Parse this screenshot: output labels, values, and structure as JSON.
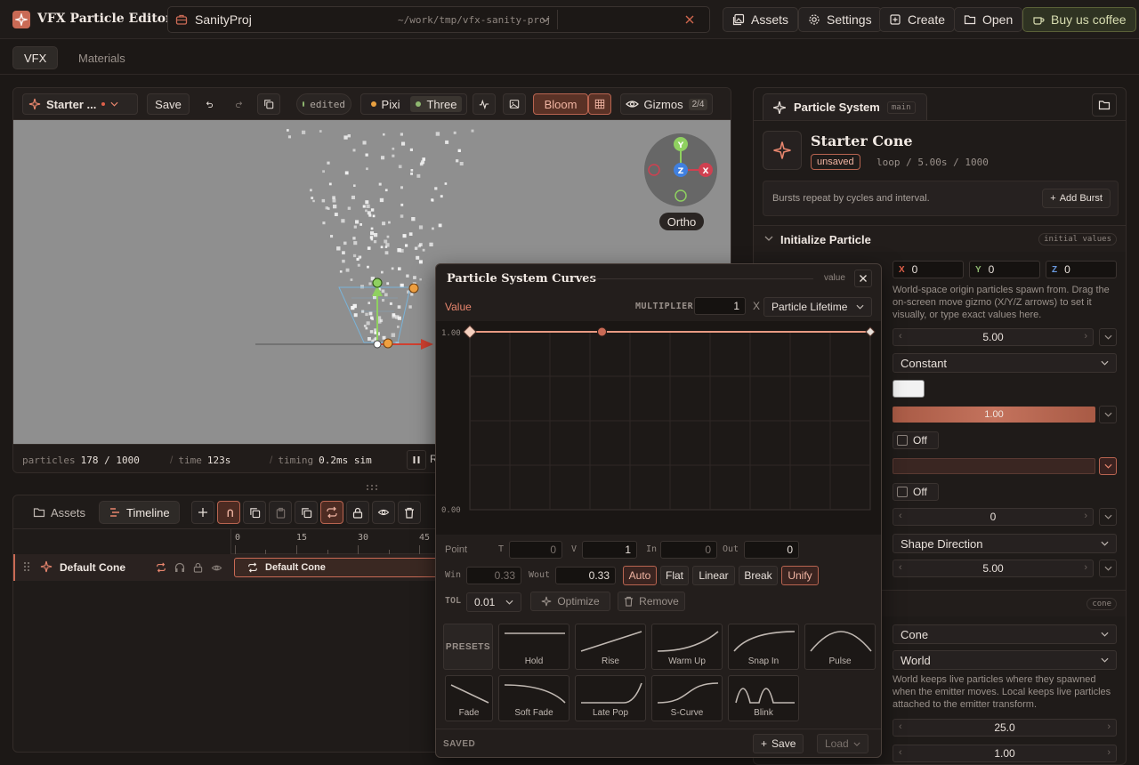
{
  "app": {
    "title": "VFX Particle Editor"
  },
  "project": {
    "name": "SanityProj",
    "path": "~/work/tmp/vfx-sanity-proj"
  },
  "toolbar": {
    "assets": "Assets",
    "settings": "Settings",
    "create": "Create",
    "open": "Open",
    "coffee": "Buy us coffee"
  },
  "main_tabs": [
    "VFX",
    "Materials"
  ],
  "viewport": {
    "system_name": "Starter ...",
    "save": "Save",
    "edited": "edited",
    "renderer_pixi": "Pixi",
    "renderer_three": "Three",
    "bloom": "Bloom",
    "gizmos": "Gizmos",
    "gizmos_count": "2/4",
    "ortho": "Ortho",
    "gizmo_axes": {
      "y": "Y",
      "z": "Z",
      "x": "X"
    },
    "stats": {
      "particles_label": "particles",
      "particles_value": "178 / 1000",
      "time_label": "time",
      "time_value": "123s",
      "timing_label": "timing",
      "timing_value": "0.2ms sim",
      "sep": "/"
    },
    "trailing_char": "R",
    "particle_count": 178,
    "particle_max": 1000
  },
  "bottom": {
    "tab_assets": "Assets",
    "tab_timeline": "Timeline",
    "ruler_ticks": [
      "0",
      "15",
      "30",
      "45"
    ],
    "track_name": "Default Cone",
    "clip_name": "Default Cone"
  },
  "inspector": {
    "tab_label": "Particle System",
    "tab_badge": "main",
    "system_name": "Starter Cone",
    "status": "unsaved",
    "meta": "loop / 5.00s / 1000",
    "burst_note": "Bursts repeat by cycles and interval.",
    "add_burst": "Add Burst",
    "init_title": "Initialize Particle",
    "init_badge": "initial values",
    "pos_x_label": "X",
    "pos_x": "0",
    "pos_y_label": "Y",
    "pos_y": "0",
    "pos_z_label": "Z",
    "pos_z": "0",
    "pos_hint": "World-space origin particles spawn from. Drag the on-screen move gizmo (X/Y/Z arrows) to set it visually, or type exact values here.",
    "lifetime": "5.00",
    "lifetime_mode": "Constant",
    "start_color": "#f2f2f2",
    "size_value": "1.00",
    "toggle1": "Off",
    "toggle2": "Off",
    "rotation": "0",
    "direction": "Shape Direction",
    "speed": "5.00",
    "shape_badge": "cone",
    "shape": "Cone",
    "sim_space": "World",
    "space_hint": "World keeps live particles where they spawned when the emitter moves. Local keeps live particles attached to the emitter transform.",
    "angle": "25.0",
    "radius": "1.00"
  },
  "curves": {
    "title": "Particle System Curves",
    "value_tag": "value",
    "value_label": "Value",
    "multiplier_label": "MULTIPLIER",
    "multiplier": "1",
    "x_label": "X",
    "x_axis": "Particle Lifetime",
    "y_max_label": "1.00",
    "y_min_label": "0.00",
    "curve_points": [
      {
        "t": 0,
        "v": 1
      },
      {
        "t": 0.33,
        "v": 1
      },
      {
        "t": 1,
        "v": 1
      }
    ],
    "point": {
      "label": "Point",
      "t_label": "T",
      "t": "0",
      "v_label": "V",
      "v": "1",
      "in_label": "In",
      "in": "0",
      "out_label": "Out",
      "out": "0"
    },
    "win_label": "Win",
    "win": "0.33",
    "wout_label": "Wout",
    "wout": "0.33",
    "modes": [
      "Auto",
      "Flat",
      "Linear",
      "Break",
      "Unify"
    ],
    "tol_label": "TOL",
    "tol": "0.01",
    "optimize": "Optimize",
    "remove": "Remove",
    "presets_label": "PRESETS",
    "presets": [
      "Hold",
      "Rise",
      "Warm Up",
      "Snap In",
      "Pulse",
      "Fade",
      "Soft Fade",
      "Late Pop",
      "S-Curve",
      "Blink"
    ],
    "saved_label": "SAVED",
    "save": "Save",
    "load": "Load"
  },
  "colors": {
    "accent": "#c96a55",
    "bg": "#1c1816",
    "viewport": "#8f8f8f",
    "curve": "#e89a82"
  }
}
